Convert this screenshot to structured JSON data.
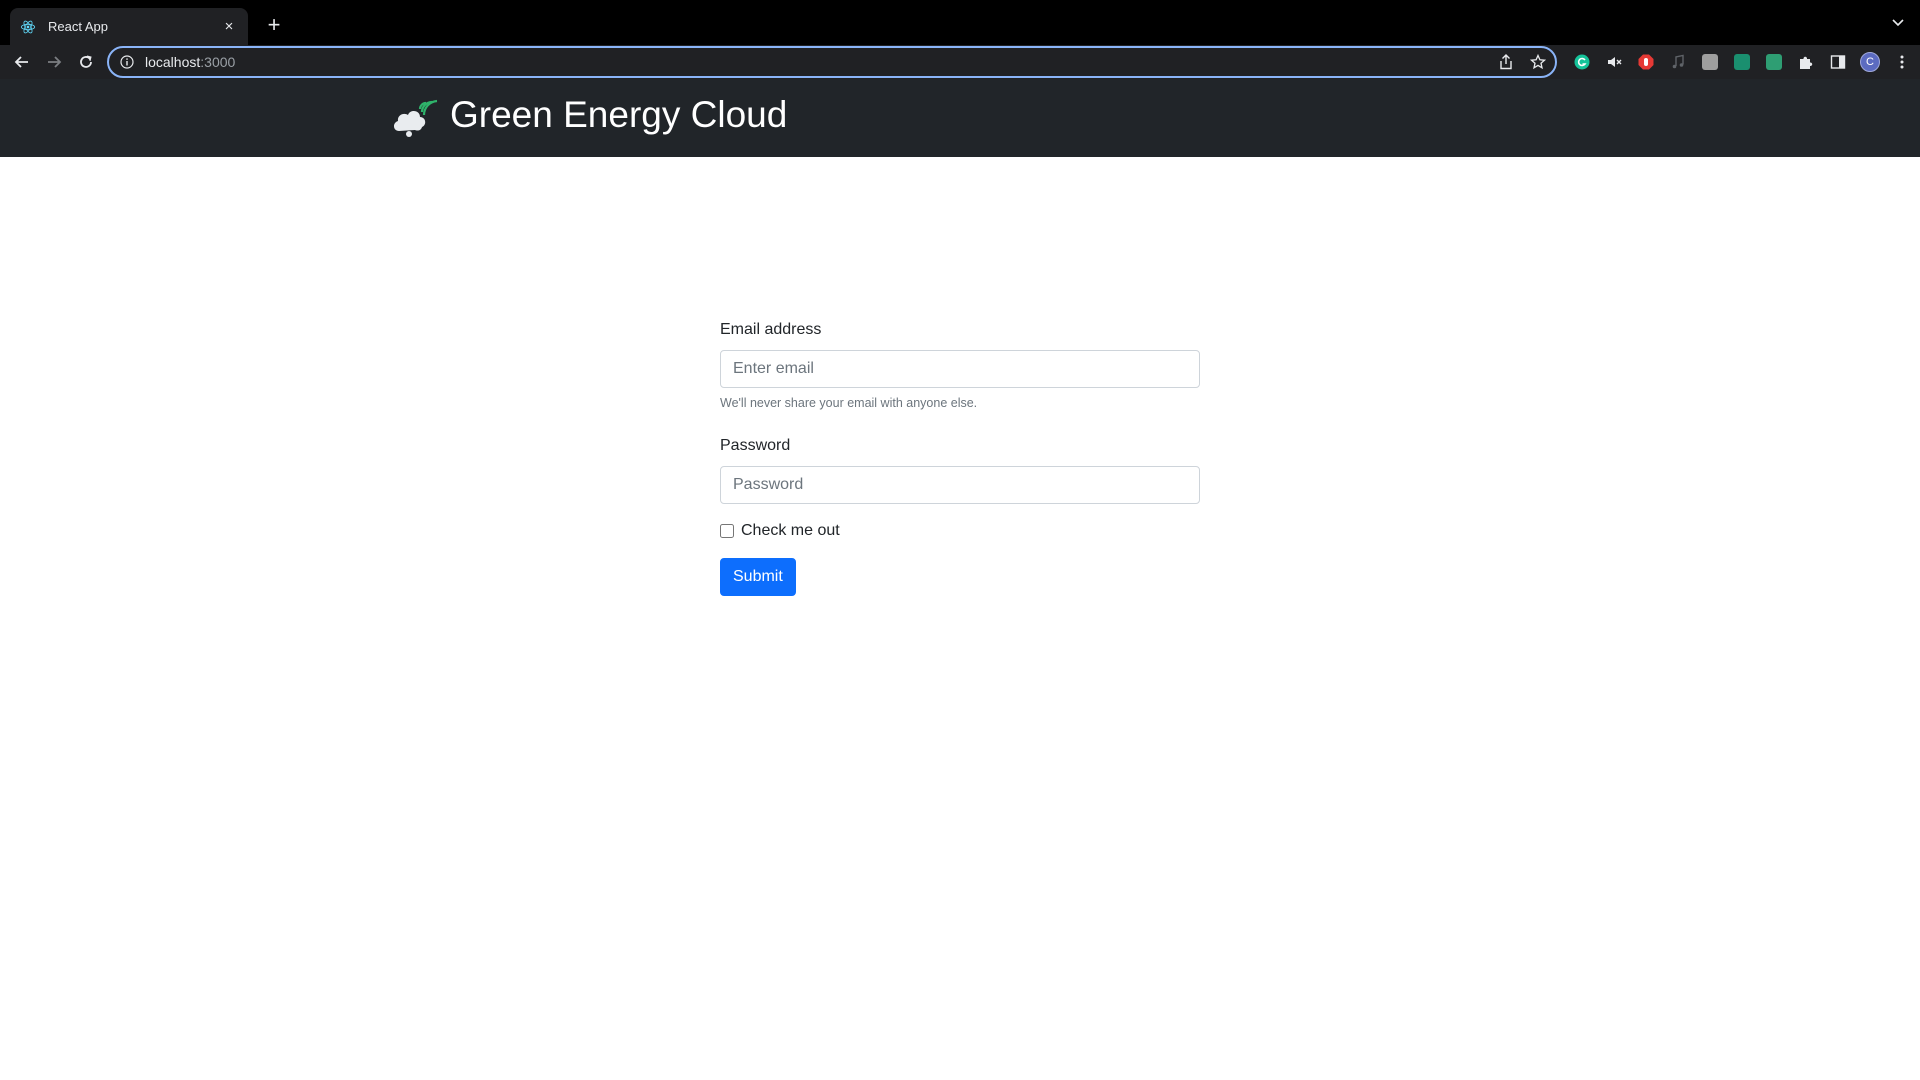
{
  "browser": {
    "tab_title": "React App",
    "tab_close": "×",
    "new_tab": "+",
    "url_host": "localhost",
    "url_port": ":3000",
    "profile_initial": "C",
    "extension_icons": [
      "grammarly-icon",
      "mute-icon",
      "adblock-icon",
      "music-note-icon",
      "ext-grey-icon",
      "ext-teal-icon",
      "ext-green-icon",
      "puzzle-icon",
      "sidepanel-icon"
    ]
  },
  "navbar": {
    "brand_name": "Green Energy Cloud",
    "logo_icon": "green-energy-cloud-logo"
  },
  "form": {
    "email_label": "Email address",
    "email_placeholder": "Enter email",
    "email_value": "",
    "email_help": "We'll never share your email with anyone else.",
    "password_label": "Password",
    "password_placeholder": "Password",
    "password_value": "",
    "checkbox_label": "Check me out",
    "checkbox_checked": false,
    "submit_label": "Submit"
  },
  "colors": {
    "navbar_bg": "#212529",
    "primary": "#0d6efd",
    "logo_accent": "#2fb36b"
  }
}
